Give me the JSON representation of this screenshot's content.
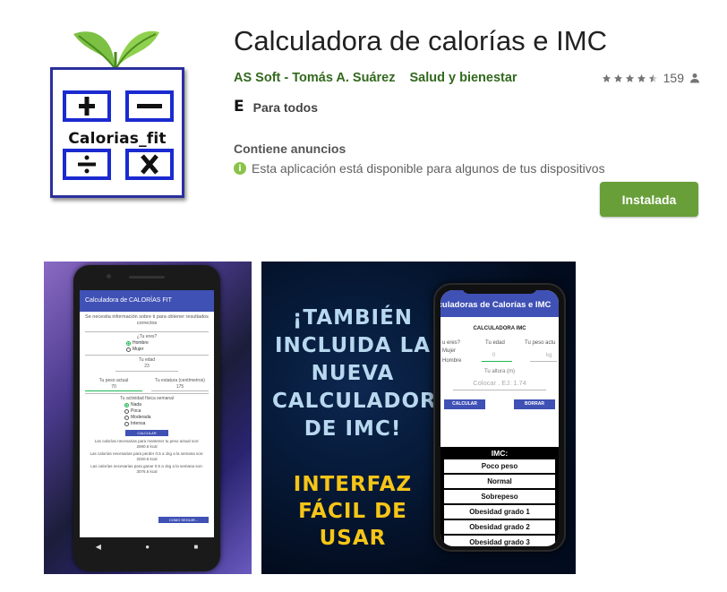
{
  "app": {
    "title": "Calculadora de calorías e IMC",
    "developer": "AS Soft - Tomás A. Suárez",
    "category": "Salud y bienestar",
    "rating_stars": 4.5,
    "rating_count": "159",
    "content_rating_symbol": "E",
    "content_rating": "Para todos",
    "ads_label": "Contiene anuncios",
    "availability": "Esta aplicación está disponible para algunos de tus dispositivos",
    "install_label": "Instalada",
    "icon_text": "Calorias_fit"
  },
  "colors": {
    "install_green": "#689f38",
    "developer_green": "#33691e",
    "app_bar_blue": "#3f51b5",
    "promo_blue": "#b8d8f0",
    "promo_yellow": "#f5c518"
  },
  "icons": {
    "star": "star-icon",
    "person": "person-icon",
    "info": "info-icon",
    "plus": "plus-icon",
    "minus": "minus-icon",
    "divide": "divide-icon",
    "times": "times-icon",
    "leaves": "leaves-icon"
  },
  "screenshot1": {
    "app_bar": "Calculadora de CALORÍAS FIT",
    "subtitle": "Se necesita información sobre ti para obtener resultados correctos",
    "sex_question": "¿Tu eres?",
    "sex_options": [
      "Hombre",
      "Mujer"
    ],
    "age_label": "Tu edad",
    "age_value": "23",
    "weight_label": "Tu peso actual",
    "weight_value": "70",
    "height_label": "Tu estatura (centímetros)",
    "height_value": "175",
    "activity_question": "Tu actividad física semanal",
    "activity_options": [
      "Nada",
      "Poca",
      "Moderada",
      "Intensa"
    ],
    "calc_button": "CALCULAR",
    "result_1": "Las calorías necesarias para mantener tu peso actual son: 2690.6 kcal",
    "result_2": "Las calorías necesarias para perder 0.5 a 1kg a la semana son: 2020.6 kcal",
    "result_3": "Las calorías necesarias para ganar 0.5 a 1kg a la semana son: 3076.6 kcal",
    "more_button": "COMO SEGUIR..."
  },
  "screenshot2": {
    "promo_title": "¡TAMBIÉN INCLUIDA LA NUEVA CALCULADORA DE IMC!",
    "promo_subtitle": "INTERFAZ FÁCIL DE USAR",
    "app_bar": "lculadoras de Calorías e IMC",
    "heading": "CALCULADORA IMC",
    "sex_question": "u eres?",
    "sex_options": [
      "Mujer",
      "Hombre"
    ],
    "age_label": "Tu edad",
    "age_placeholder": "0",
    "weight_label": "Tu peso actu",
    "weight_unit": "kg",
    "height_label": "Tu altura (m)",
    "height_placeholder": "Colocar . EJ: 1.74",
    "calc_button": "CALCULAR",
    "clear_button": "BORRAR",
    "imc_title": "IMC:",
    "imc_items": [
      "Poco peso",
      "Normal",
      "Sobrepeso",
      "Obesidad grado 1",
      "Obesidad grado 2",
      "Obesidad grado 3"
    ]
  }
}
